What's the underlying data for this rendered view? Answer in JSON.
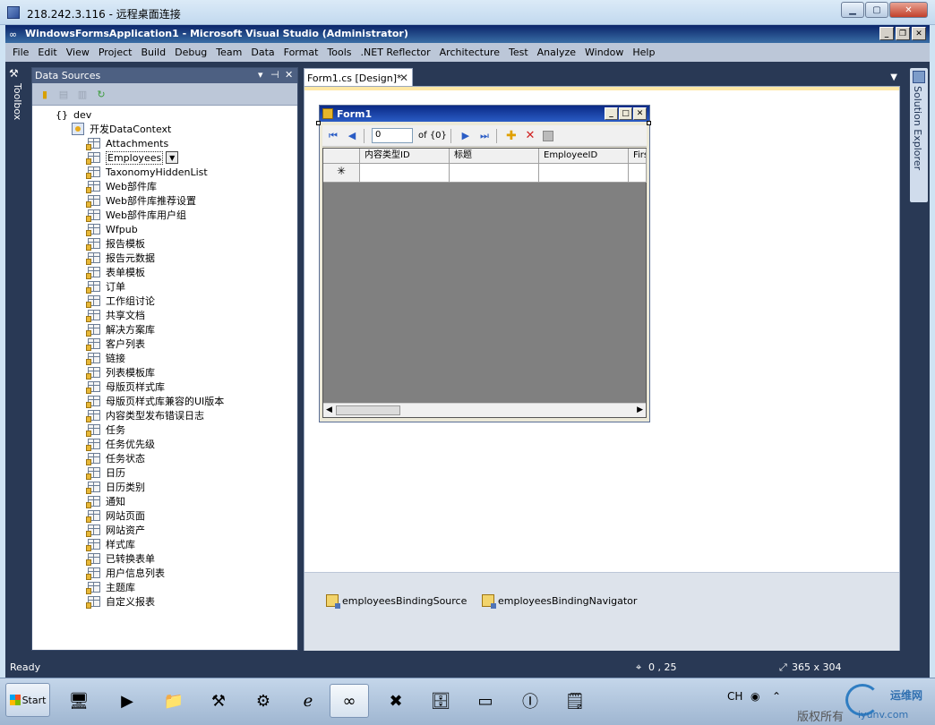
{
  "rdp": {
    "title": "218.242.3.116 - 远程桌面连接"
  },
  "vs": {
    "title": "WindowsFormsApplication1 - Microsoft Visual Studio (Administrator)",
    "menu": [
      "File",
      "Edit",
      "View",
      "Project",
      "Build",
      "Debug",
      "Team",
      "Data",
      "Format",
      "Tools",
      ".NET Reflector",
      "Architecture",
      "Test",
      "Analyze",
      "Window",
      "Help"
    ],
    "toolbox_label": "Toolbox",
    "solution_explorer_label": "Solution Explorer"
  },
  "data_sources": {
    "title": "Data Sources",
    "pin_glyph": "▾ ┃ ✕",
    "root": "dev",
    "root_glyph": "{}",
    "context": "开发DataContext",
    "tables": [
      "Attachments",
      "Employees",
      "TaxonomyHiddenList",
      "Web部件库",
      "Web部件库推荐设置",
      "Web部件库用户组",
      "Wfpub",
      "报告模板",
      "报告元数据",
      "表单模板",
      "订单",
      "工作组讨论",
      "共享文档",
      "解决方案库",
      "客户列表",
      "链接",
      "列表模板库",
      "母版页样式库",
      "母版页样式库兼容的UI版本",
      "内容类型发布错误日志",
      "任务",
      "任务优先级",
      "任务状态",
      "日历",
      "日历类别",
      "通知",
      "网站页面",
      "网站资产",
      "样式库",
      "已转换表单",
      "用户信息列表",
      "主题库",
      "自定义报表"
    ],
    "selected_index": 1
  },
  "document": {
    "tab_label": "Form1.cs [Design]*",
    "form_title": "Form1",
    "navigator": {
      "position": "0",
      "count": "of {0}"
    },
    "grid": {
      "columns": [
        "内容类型ID",
        "标题",
        "EmployeeID",
        "Firs"
      ],
      "new_row_glyph": "✳"
    },
    "tray_items": [
      "employeesBindingSource",
      "employeesBindingNavigator"
    ]
  },
  "status": {
    "text": "Ready",
    "position": "0 , 25",
    "size": "365 x 304"
  },
  "taskbar": {
    "start_label": "Start",
    "lang": "CH",
    "watermark_text": "版权所有",
    "watermark_logo": "运维网",
    "watermark_site": "iyunv.com"
  },
  "colors": {
    "vs_chrome": "#293955",
    "panel_header": "#4d6082",
    "menubar": "#bcc7d8",
    "grid_background": "#808080"
  }
}
